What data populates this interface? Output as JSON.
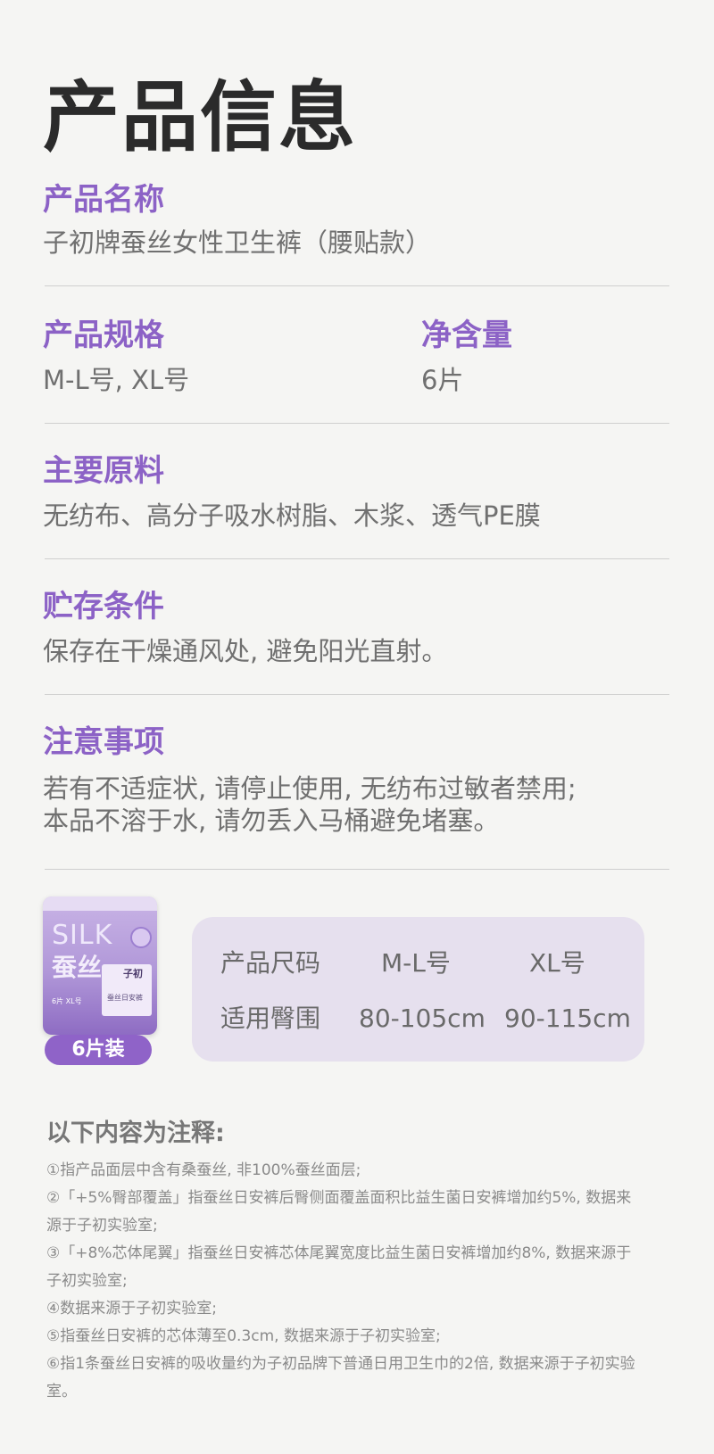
{
  "title": "产品信息",
  "sections": {
    "name": {
      "label": "产品名称",
      "value": "子初牌蚕丝女性卫生裤（腰贴款）"
    },
    "spec": {
      "label": "产品规格",
      "value": "M-L号, XL号"
    },
    "net": {
      "label": "净含量",
      "value": "6片"
    },
    "material": {
      "label": "主要原料",
      "value": "无纺布、高分子吸水树脂、木浆、透气PE膜"
    },
    "storage": {
      "label": "贮存条件",
      "value": "保存在干燥通风处, 避免阳光直射。"
    },
    "caution": {
      "label": "注意事项",
      "lines": [
        "若有不适症状, 请停止使用, 无纺布过敏者禁用;",
        "本品不溶于水, 请勿丢入马桶避免堵塞。"
      ]
    }
  },
  "package": {
    "silk_text": "SILK",
    "cn_text": "蚕丝",
    "logo": "子初",
    "sub_text": "蚕丝日安裤",
    "size_text": "6片 XL号",
    "badge": "6片装"
  },
  "size_table": {
    "header": [
      "产品尺码",
      "M-L号",
      "XL号"
    ],
    "row": [
      "适用臀围",
      "80-105cm",
      "90-115cm"
    ]
  },
  "notes": {
    "title": "以下内容为注释:",
    "items": [
      "①指产品面层中含有桑蚕丝, 非100%蚕丝面层;",
      "②「+5%臀部覆盖」指蚕丝日安裤后臀侧面覆盖面积比益生菌日安裤增加约5%, 数据来源于子初实验室;",
      "③「+8%芯体尾翼」指蚕丝日安裤芯体尾翼宽度比益生菌日安裤增加约8%, 数据来源于子初实验室;",
      "④数据来源于子初实验室;",
      "⑤指蚕丝日安裤的芯体薄至0.3cm, 数据来源于子初实验室;",
      "⑥指1条蚕丝日安裤的吸收量约为子初品牌下普通日用卫生巾的2倍, 数据来源于子初实验室。"
    ]
  },
  "colors": {
    "accent": "#8c62c6",
    "title": "#2b2b2b",
    "text": "#707070",
    "card": "#e6e0ee"
  }
}
